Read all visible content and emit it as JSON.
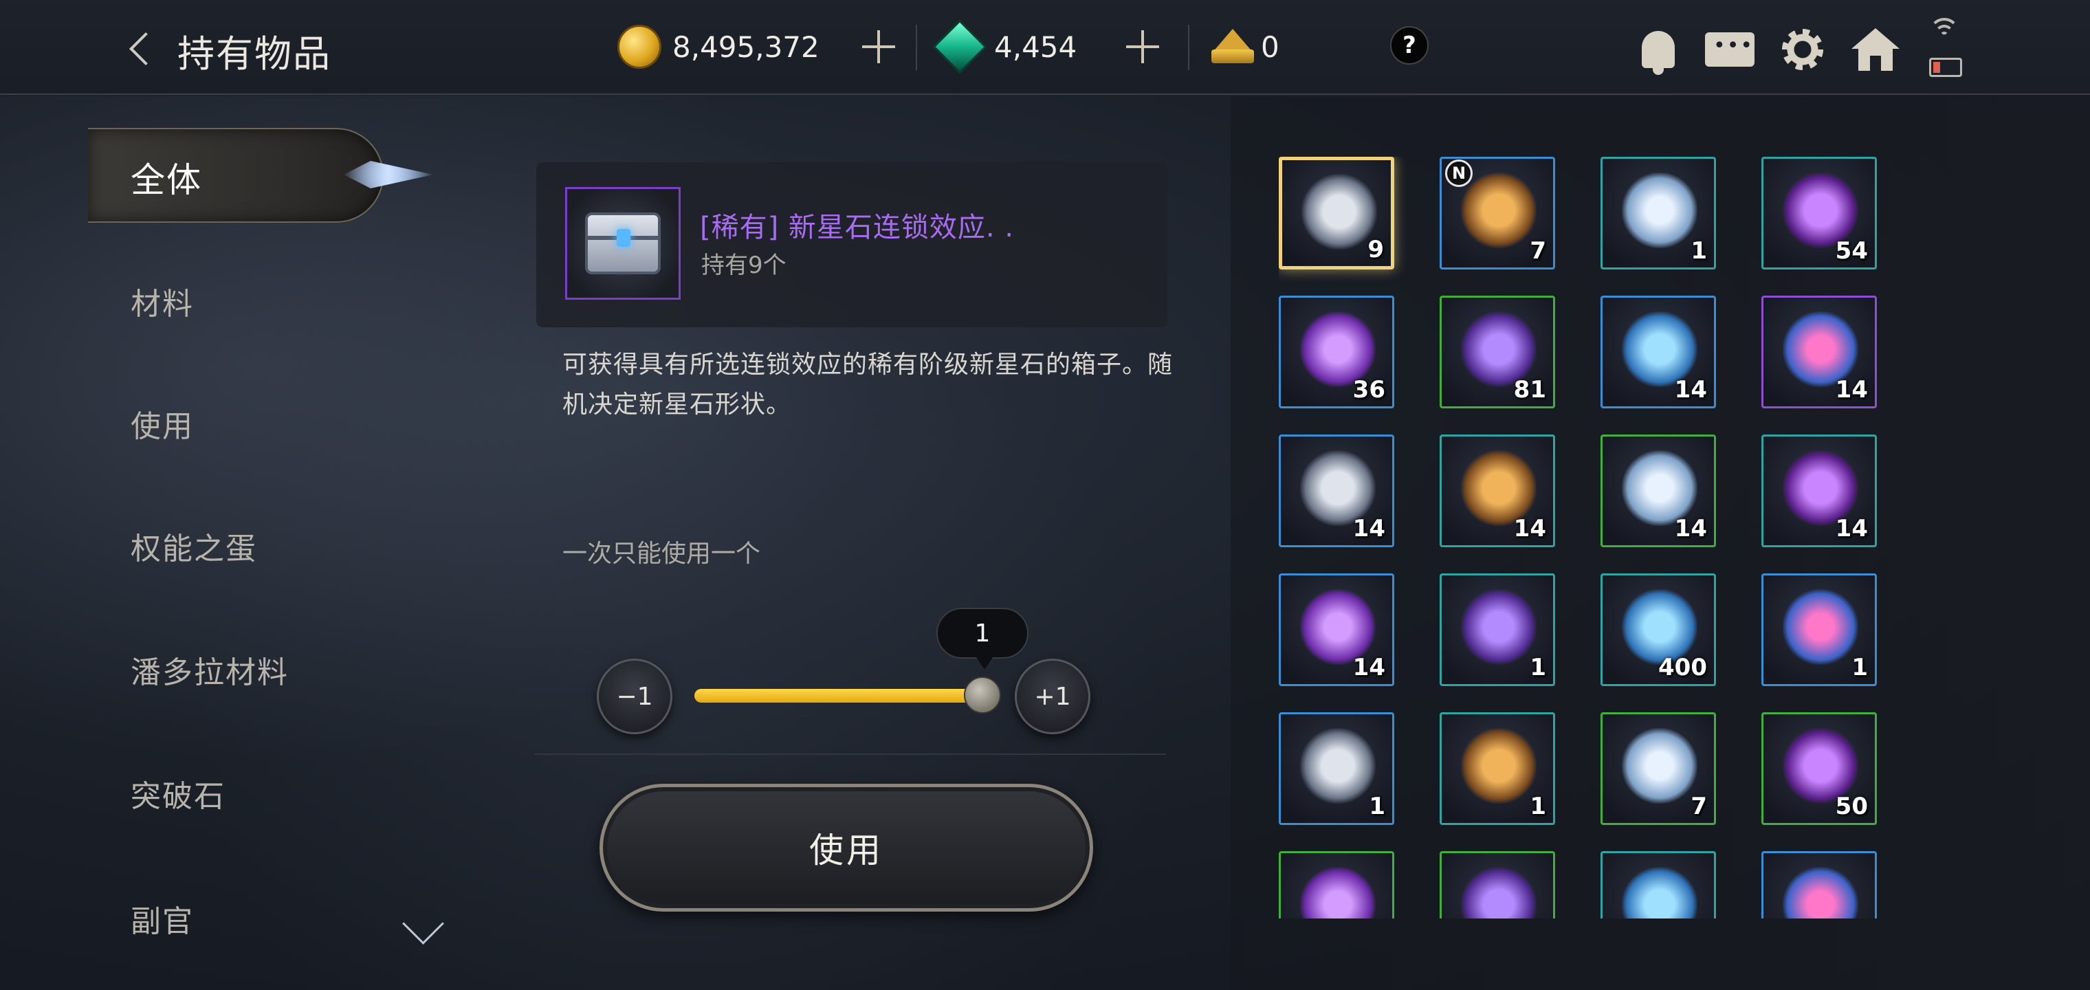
{
  "header": {
    "title": "持有物品",
    "gold": "8,495,372",
    "gems": "4,454",
    "crowns": "0",
    "help": "?"
  },
  "nav": {
    "active": "全体",
    "items": [
      "材料",
      "使用",
      "权能之蛋",
      "潘多拉材料",
      "突破石",
      "副官"
    ]
  },
  "detail": {
    "name": "[稀有] 新星石连锁效应. .",
    "owned": "持有9个",
    "description": "可获得具有所选连锁效应的稀有阶级新星石的箱子。随机决定新星石形状。",
    "limit_note": "一次只能使用一个",
    "quantity": "1",
    "minus_label": "−1",
    "plus_label": "+1",
    "slider_fraction": 1.0,
    "use_label": "使用"
  },
  "inventory": {
    "new_badge": "N",
    "items": [
      {
        "count": "9",
        "rarity": "selected",
        "icon": "silver-chest-icon"
      },
      {
        "count": "7",
        "rarity": "blue",
        "icon": "pouch-icon"
      },
      {
        "count": "1",
        "rarity": "teal",
        "icon": "feather-icon"
      },
      {
        "count": "54",
        "rarity": "teal",
        "icon": "amethyst-icon"
      },
      {
        "count": "36",
        "rarity": "blue",
        "icon": "purple-gem-icon"
      },
      {
        "count": "81",
        "rarity": "green",
        "icon": "crystal-icon"
      },
      {
        "count": "14",
        "rarity": "blue",
        "icon": "potion-bottle-icon"
      },
      {
        "count": "14",
        "rarity": "purple",
        "icon": "pink-feather-icon"
      },
      {
        "count": "14",
        "rarity": "blue",
        "icon": "wing-icon"
      },
      {
        "count": "14",
        "rarity": "teal",
        "icon": "skull-icon"
      },
      {
        "count": "14",
        "rarity": "green",
        "icon": "staff-orb-icon"
      },
      {
        "count": "14",
        "rarity": "teal",
        "icon": "tongs-icon"
      },
      {
        "count": "14",
        "rarity": "blue",
        "icon": "horn-icon"
      },
      {
        "count": "1",
        "rarity": "teal",
        "icon": "twin-blades-icon"
      },
      {
        "count": "400",
        "rarity": "teal",
        "icon": "blue-shard-icon"
      },
      {
        "count": "1",
        "rarity": "blue",
        "icon": "white-flame-icon"
      },
      {
        "count": "1",
        "rarity": "blue",
        "icon": "sword-hilt-icon"
      },
      {
        "count": "1",
        "rarity": "teal",
        "icon": "sword-hilt-icon"
      },
      {
        "count": "7",
        "rarity": "green",
        "icon": "claw-icon"
      },
      {
        "count": "50",
        "rarity": "green",
        "icon": "gold-rune-icon"
      },
      {
        "count": "",
        "rarity": "green",
        "icon": "red-rune-icon"
      },
      {
        "count": "",
        "rarity": "green",
        "icon": "blue-scale-icon"
      },
      {
        "count": "",
        "rarity": "teal",
        "icon": "hammer-icon"
      },
      {
        "count": "",
        "rarity": "blue",
        "icon": "axe-icon"
      }
    ]
  },
  "colors": {
    "accent_gold": "#f0d27a",
    "rarity_purple": "#a86cf0",
    "slider_fill": "#ffd84a"
  }
}
